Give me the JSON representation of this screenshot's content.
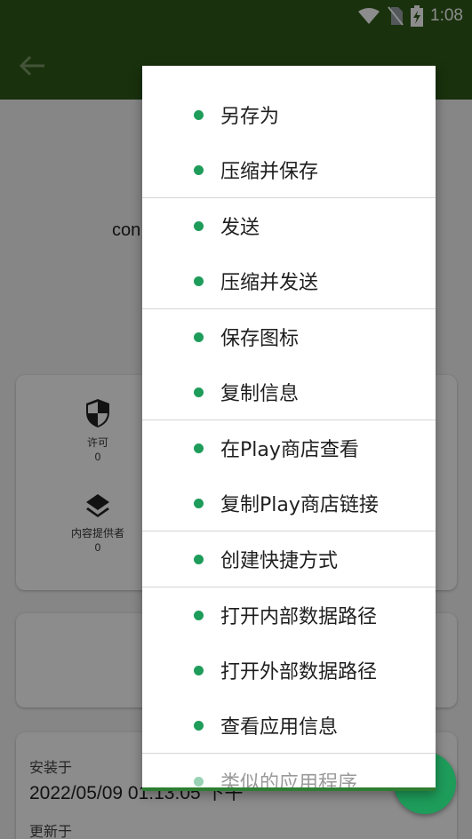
{
  "status_bar": {
    "time": "1:08"
  },
  "background": {
    "package_name": "con",
    "stats": [
      {
        "label": "许可",
        "value": "0",
        "icon": "shield-icon"
      },
      {
        "label": "内容提供者",
        "value": "0",
        "icon": "layers-icon"
      }
    ],
    "install": {
      "label": "安装于",
      "value": "2022/05/09 01:13:05 下午"
    },
    "update": {
      "label": "更新于"
    }
  },
  "menu": {
    "groups": [
      [
        "另存为",
        "压缩并保存"
      ],
      [
        "发送",
        "压缩并发送"
      ],
      [
        "保存图标",
        "复制信息"
      ],
      [
        "在Play商店查看",
        "复制Play商店链接"
      ],
      [
        "创建快捷方式"
      ],
      [
        "打开内部数据路径",
        "打开外部数据路径",
        "查看应用信息"
      ],
      [
        "类似的应用程序"
      ]
    ]
  },
  "colors": {
    "app_bar": "#2f5a18",
    "accent": "#1e9c5a"
  }
}
